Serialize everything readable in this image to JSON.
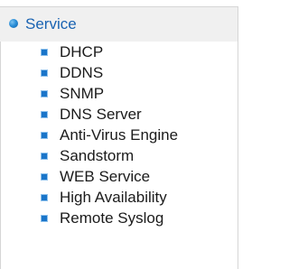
{
  "menu": {
    "header": {
      "label": "Service",
      "icon": "round-bullet-icon"
    },
    "items": [
      {
        "label": "DHCP",
        "icon": "square-bullet-icon"
      },
      {
        "label": "DDNS",
        "icon": "square-bullet-icon"
      },
      {
        "label": "SNMP",
        "icon": "square-bullet-icon"
      },
      {
        "label": "DNS Server",
        "icon": "square-bullet-icon"
      },
      {
        "label": "Anti-Virus Engine",
        "icon": "square-bullet-icon"
      },
      {
        "label": "Sandstorm",
        "icon": "square-bullet-icon"
      },
      {
        "label": "WEB Service",
        "icon": "square-bullet-icon"
      },
      {
        "label": "High Availability",
        "icon": "square-bullet-icon"
      },
      {
        "label": "Remote Syslog",
        "icon": "square-bullet-icon"
      }
    ]
  },
  "colors": {
    "header_background": "#f0f0f0",
    "header_text": "#1a63b2",
    "bullet_blue": "#1a75c9",
    "item_text": "#1b1b1b",
    "border": "#d6d6d6"
  }
}
